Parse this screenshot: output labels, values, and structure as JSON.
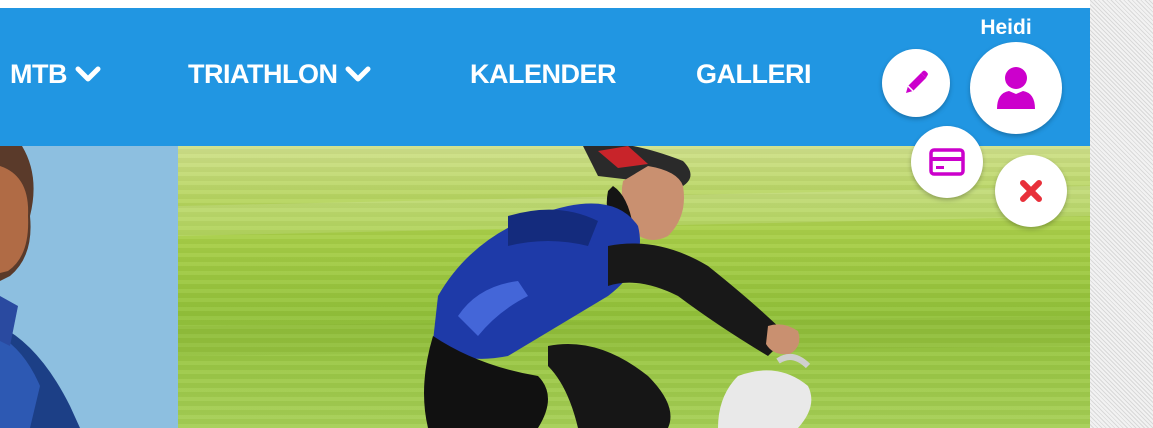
{
  "nav": {
    "items": [
      {
        "label": "MTB",
        "has_dropdown": true
      },
      {
        "label": "TRIATHLON",
        "has_dropdown": true
      },
      {
        "label": "KALENDER",
        "has_dropdown": false
      },
      {
        "label": "GALLERI",
        "has_dropdown": false
      }
    ]
  },
  "user": {
    "name": "Heidi"
  },
  "actions": {
    "edit_icon": "pencil-icon",
    "profile_icon": "user-icon",
    "card_icon": "credit-card-icon",
    "close_icon": "close-icon"
  },
  "colors": {
    "nav_bg": "#2196e2",
    "action_icon": "#cc00cc",
    "close_icon": "#e8303a"
  }
}
